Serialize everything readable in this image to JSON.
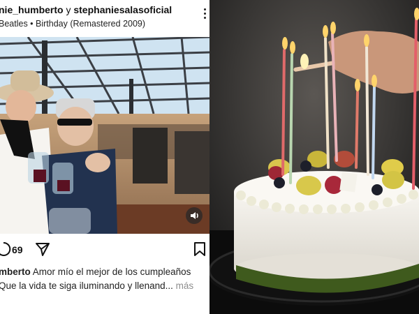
{
  "post": {
    "usernames_text": "nie_humberto",
    "joiner": " y ",
    "coauthor": "stephaniesalasoficial",
    "song": "Beatles • Birthday (Remastered 2009)",
    "comment_count": "69",
    "caption": {
      "user": "mberto",
      "line1_text": " Amor mío el mejor de los cumpleaños",
      "line2_text": "Que la vida te siga iluminando y llenand...",
      "more": " más"
    }
  },
  "icons": {
    "more": "more-options-icon",
    "comment": "comment-icon",
    "share": "share-icon",
    "save": "bookmark-icon",
    "mute": "speaker-icon"
  },
  "colors": {
    "text": "#111111",
    "muted": "#8e8e8e",
    "cake_frosting": "#f4f1ea",
    "candle_flame": "#ffd46b"
  }
}
